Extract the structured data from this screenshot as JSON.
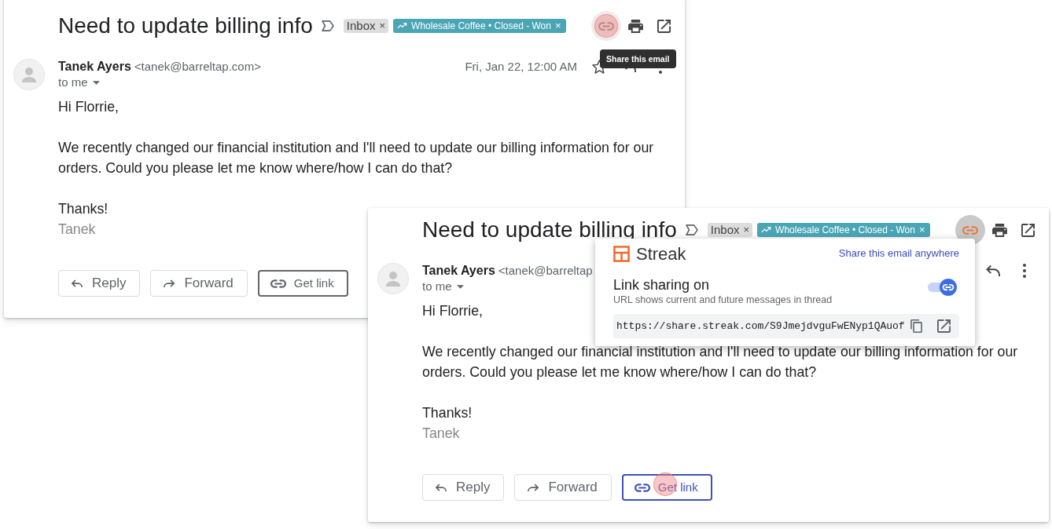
{
  "views": [
    {
      "subject": "Need to update billing info",
      "labels": [
        {
          "kind": "folder",
          "text": "Inbox",
          "close": "×"
        },
        {
          "kind": "pipeline",
          "text": "Wholesale Coffee • Closed - Won",
          "close": "×"
        }
      ],
      "share_button": {
        "link_on": false,
        "clicked": true,
        "tooltip": "Share this email"
      },
      "sender": {
        "name": "Tanek Ayers",
        "email": "<tanek@barreltap.com>",
        "recipient": "to me"
      },
      "date": "Fri, Jan 22, 12:00 AM",
      "actions": [
        {
          "kind": "star"
        },
        {
          "kind": "reply"
        },
        {
          "kind": "more"
        }
      ],
      "body": [
        "Hi Florrie,",
        "We recently changed our financial institution and I'll need to update our billing information for our orders. Could you please let me know where/how I can do that?",
        "Thanks!"
      ],
      "signature": "Tanek",
      "buttons": [
        {
          "kind": "reply",
          "label": "Reply",
          "active": false,
          "clicked": false
        },
        {
          "kind": "forward",
          "label": "Forward",
          "active": false,
          "clicked": false
        },
        {
          "kind": "get_link",
          "label": "Get link",
          "active": false,
          "clicked": false
        }
      ]
    },
    {
      "subject": "Need to update billing info",
      "labels": [
        {
          "kind": "folder",
          "text": "Inbox",
          "close": "×"
        },
        {
          "kind": "pipeline",
          "text": "Wholesale Coffee • Closed - Won",
          "close": "×"
        }
      ],
      "share_button": {
        "link_on": true,
        "clicked": false
      },
      "popup": {
        "brand": "Streak",
        "link": "Share this email anywhere",
        "setting": "Link sharing on",
        "description": "URL shows current and future messages in thread",
        "sharing_on": true,
        "url": "https://share.streak.com/S9JmejdvguFwENyp1QAuof"
      },
      "sender": {
        "name": "Tanek Ayers",
        "email": "<tanek@barreltap",
        "recipient": "to me"
      },
      "actions": [
        {
          "kind": "reply"
        },
        {
          "kind": "more"
        }
      ],
      "body": [
        "Hi Florrie,",
        "We recently changed our financial institution and I'll need to update our billing information for our orders. Could you please let me know where/how I can do that?",
        "Thanks!"
      ],
      "signature": "Tanek",
      "buttons": [
        {
          "kind": "reply",
          "label": "Reply",
          "active": false,
          "clicked": false
        },
        {
          "kind": "forward",
          "label": "Forward",
          "active": false,
          "clicked": false
        },
        {
          "kind": "get_link",
          "label": "Get link",
          "active": true,
          "clicked": true
        }
      ]
    }
  ]
}
